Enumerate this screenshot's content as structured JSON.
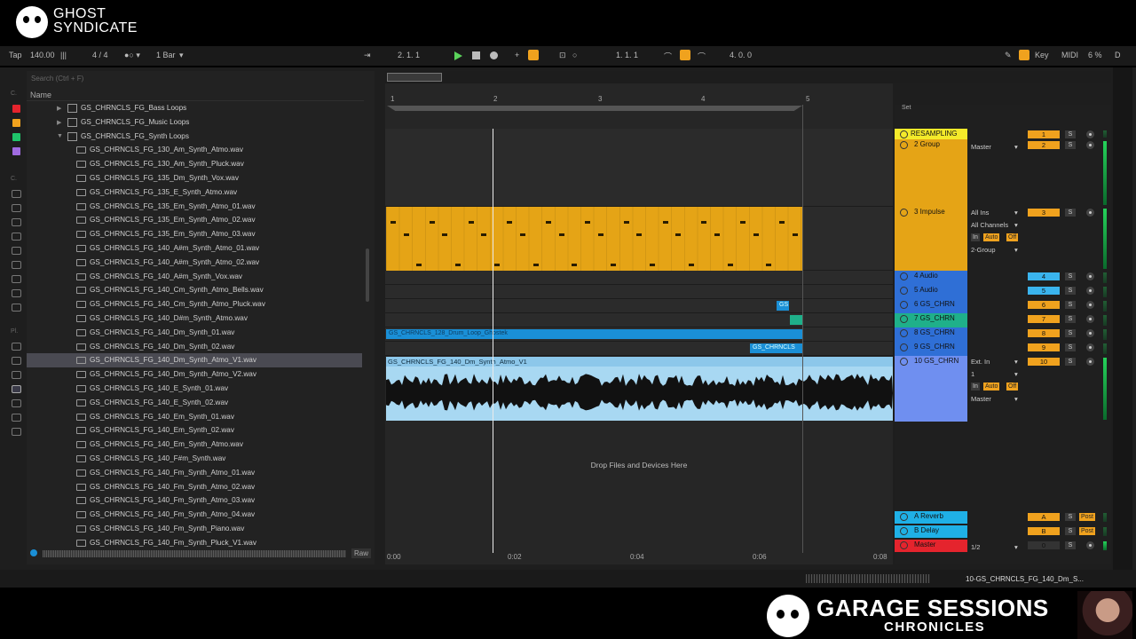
{
  "brand": {
    "line1": "GHOST",
    "line2": "SYNDICATE"
  },
  "transport": {
    "tap": "Tap",
    "tempo": "140.00",
    "time_sig": "4 / 4",
    "quantize": "1 Bar",
    "position": "2.  1.  1",
    "loop_start": "1.  1.  1",
    "loop_length": "4.  0.  0",
    "key": "Key",
    "midi": "MIDI",
    "cpu": "6 %",
    "d": "D"
  },
  "browser": {
    "search_placeholder": "Search (Ctrl + F)",
    "name_header": "Name",
    "raw_label": "Raw",
    "folders": [
      "GS_CHRNCLS_FG_Bass Loops",
      "GS_CHRNCLS_FG_Music Loops",
      "GS_CHRNCLS_FG_Synth Loops"
    ],
    "files": [
      "GS_CHRNCLS_FG_130_Am_Synth_Atmo.wav",
      "GS_CHRNCLS_FG_130_Am_Synth_Pluck.wav",
      "GS_CHRNCLS_FG_135_Dm_Synth_Vox.wav",
      "GS_CHRNCLS_FG_135_E_Synth_Atmo.wav",
      "GS_CHRNCLS_FG_135_Em_Synth_Atmo_01.wav",
      "GS_CHRNCLS_FG_135_Em_Synth_Atmo_02.wav",
      "GS_CHRNCLS_FG_135_Em_Synth_Atmo_03.wav",
      "GS_CHRNCLS_FG_140_A#m_Synth_Atmo_01.wav",
      "GS_CHRNCLS_FG_140_A#m_Synth_Atmo_02.wav",
      "GS_CHRNCLS_FG_140_A#m_Synth_Vox.wav",
      "GS_CHRNCLS_FG_140_Cm_Synth_Atmo_Bells.wav",
      "GS_CHRNCLS_FG_140_Cm_Synth_Atmo_Pluck.wav",
      "GS_CHRNCLS_FG_140_D#m_Synth_Atmo.wav",
      "GS_CHRNCLS_FG_140_Dm_Synth_01.wav",
      "GS_CHRNCLS_FG_140_Dm_Synth_02.wav",
      "GS_CHRNCLS_FG_140_Dm_Synth_Atmo_V1.wav",
      "GS_CHRNCLS_FG_140_Dm_Synth_Atmo_V2.wav",
      "GS_CHRNCLS_FG_140_E_Synth_01.wav",
      "GS_CHRNCLS_FG_140_E_Synth_02.wav",
      "GS_CHRNCLS_FG_140_Em_Synth_01.wav",
      "GS_CHRNCLS_FG_140_Em_Synth_02.wav",
      "GS_CHRNCLS_FG_140_Em_Synth_Atmo.wav",
      "GS_CHRNCLS_FG_140_F#m_Synth.wav",
      "GS_CHRNCLS_FG_140_Fm_Synth_Atmo_01.wav",
      "GS_CHRNCLS_FG_140_Fm_Synth_Atmo_02.wav",
      "GS_CHRNCLS_FG_140_Fm_Synth_Atmo_03.wav",
      "GS_CHRNCLS_FG_140_Fm_Synth_Atmo_04.wav",
      "GS_CHRNCLS_FG_140_Fm_Synth_Piano.wav",
      "GS_CHRNCLS_FG_140_Fm_Synth_Pluck_V1.wav"
    ],
    "selected_file": "GS_CHRNCLS_FG_140_Dm_Synth_Atmo_V1.wav"
  },
  "arrangement": {
    "bar_numbers": [
      "1",
      "2",
      "3",
      "4",
      "5"
    ],
    "time_labels": [
      "0:00",
      "0:02",
      "0:04",
      "0:06",
      "0:08"
    ],
    "clip_drum": "GS_CHRNCLS_128_Drum_Loop_Ghostek",
    "clip_gs_small": "GS",
    "clip_gs_chrncls": "GS_CHRNCLS",
    "audio_clip": "GS_CHRNCLS_FG_140_Dm_Synth_Atmo_V1",
    "drop_text": "Drop Files and Devices Here",
    "set_label": "Set"
  },
  "tracks": [
    {
      "name": "RESAMPLING",
      "num": "1",
      "color": "#f4ea2a"
    },
    {
      "name": "2 Group",
      "num": "2",
      "color": "#e5a416",
      "io": "Master"
    },
    {
      "name": "3 Impulse",
      "num": "3",
      "color": "#e5a416",
      "io1": "All Ins",
      "io2": "All Channels",
      "io3": "2-Group"
    },
    {
      "name": "4 Audio",
      "num": "4",
      "color": "#2f6fd6"
    },
    {
      "name": "5 Audio",
      "num": "5",
      "color": "#2f6fd6"
    },
    {
      "name": "6 GS_CHRN",
      "num": "6",
      "color": "#2f6fd6"
    },
    {
      "name": "7 GS_CHRN",
      "num": "7",
      "color": "#1fb08a"
    },
    {
      "name": "8 GS_CHRN",
      "num": "8",
      "color": "#2f6fd6"
    },
    {
      "name": "9 GS_CHRN",
      "num": "9",
      "color": "#2f6fd6"
    },
    {
      "name": "10 GS_CHRN",
      "num": "10",
      "color": "#6f8ff0",
      "io1": "Ext. In",
      "io2": "1",
      "io3": "Master"
    },
    {
      "name": "A Reverb",
      "num": "A",
      "color": "#1fb0e6"
    },
    {
      "name": "B Delay",
      "num": "B",
      "color": "#1fb0e6"
    },
    {
      "name": "Master",
      "num": "0",
      "color": "#e5242d",
      "io": "1/2"
    }
  ],
  "mixer": {
    "s": "S",
    "c": "C",
    "in": "In",
    "auto": "Auto",
    "off": "Off",
    "inf": "-inf",
    "zero": "0",
    "post": "Post"
  },
  "status": {
    "file": "10-GS_CHRNCLS_FG_140_Dm_S..."
  },
  "footer": {
    "title": "GARAGE SESSIONS",
    "subtitle": "CHRONICLES"
  }
}
